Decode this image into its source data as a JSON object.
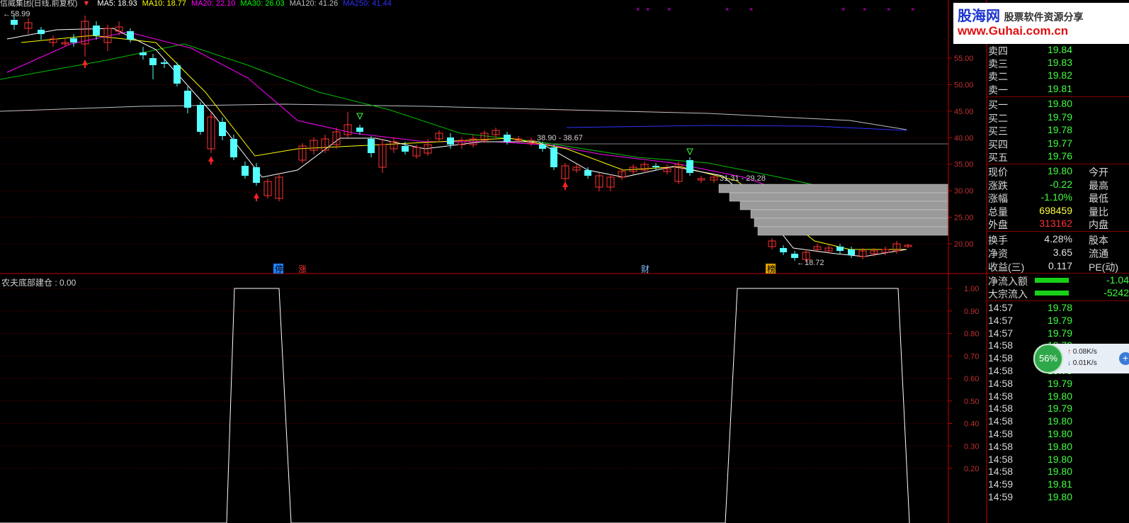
{
  "header": {
    "stock_title": "信威集团(日线,前复权)",
    "ma_items": [
      {
        "label": "MA5: 18.93",
        "color": "#ffffff"
      },
      {
        "label": "MA10: 18.77",
        "color": "#ffff00"
      },
      {
        "label": "MA20: 22.10",
        "color": "#ff00ff"
      },
      {
        "label": "MA30: 26.03",
        "color": "#00ff00"
      },
      {
        "label": "MA120: 41.26",
        "color": "#c0c0c0"
      },
      {
        "label": "MA250: 41.44",
        "color": "#3030ff"
      }
    ],
    "high_marker": "58.99"
  },
  "colors": {
    "up": "#ff3232",
    "down": "#54ffff",
    "grid": "#800000",
    "axis": "#c00000",
    "hline": "#808080"
  },
  "main_chart": {
    "y_ticks": [
      "55.00",
      "50.00",
      "45.00",
      "40.00",
      "35.00",
      "30.00",
      "25.00",
      "20.00"
    ],
    "annotations": [
      "38.90 - 38.67",
      "31.31 - 29.28",
      "18.72"
    ],
    "markers": [
      "停",
      "涨",
      "财",
      "榜"
    ]
  },
  "indicator": {
    "title": "农夫底部建仓 : 0.00",
    "y_ticks": [
      "1.00",
      "0.90",
      "0.80",
      "0.70",
      "0.60",
      "0.50",
      "0.40",
      "0.30",
      "0.20"
    ]
  },
  "quote_panel": {
    "asks": [
      {
        "label": "卖四",
        "price": "19.84"
      },
      {
        "label": "卖三",
        "price": "19.83"
      },
      {
        "label": "卖二",
        "price": "19.82"
      },
      {
        "label": "卖一",
        "price": "19.81"
      }
    ],
    "bids": [
      {
        "label": "买一",
        "price": "19.80"
      },
      {
        "label": "买二",
        "price": "19.79"
      },
      {
        "label": "买三",
        "price": "19.78"
      },
      {
        "label": "买四",
        "price": "19.77"
      },
      {
        "label": "买五",
        "price": "19.76"
      }
    ],
    "stats": [
      {
        "label": "现价",
        "value": "19.80",
        "label2": "今开"
      },
      {
        "label": "涨跌",
        "value": "-0.22",
        "label2": "最高"
      },
      {
        "label": "涨幅",
        "value": "-1.10%",
        "label2": "最低"
      },
      {
        "label": "总量",
        "value": "698459",
        "label2": "量比"
      },
      {
        "label": "外盘",
        "value": "313162",
        "label2": "内盘"
      },
      {
        "label": "换手",
        "value": "4.28%",
        "label2": "股本"
      },
      {
        "label": "净资",
        "value": "3.65",
        "label2": "流通"
      },
      {
        "label": "收益(三)",
        "value": "0.117",
        "label2": "PE(动)"
      }
    ],
    "flows": [
      {
        "label": "净流入额",
        "value": "-1.04"
      },
      {
        "label": "大宗流入",
        "value": "-5242"
      }
    ],
    "ticks": [
      {
        "time": "14:57",
        "price": "19.78"
      },
      {
        "time": "14:57",
        "price": "19.79"
      },
      {
        "time": "14:57",
        "price": "19.79"
      },
      {
        "time": "14:58",
        "price": "19.79"
      },
      {
        "time": "14:58",
        "price": "19.79"
      },
      {
        "time": "14:58",
        "price": "19.79"
      },
      {
        "time": "14:58",
        "price": "19.79"
      },
      {
        "time": "14:58",
        "price": "19.80"
      },
      {
        "time": "14:58",
        "price": "19.79"
      },
      {
        "time": "14:58",
        "price": "19.80"
      },
      {
        "time": "14:58",
        "price": "19.80"
      },
      {
        "time": "14:58",
        "price": "19.80"
      },
      {
        "time": "14:58",
        "price": "19.80"
      },
      {
        "time": "14:58",
        "price": "19.80"
      },
      {
        "time": "14:59",
        "price": "19.81"
      },
      {
        "time": "14:59",
        "price": "19.80"
      }
    ]
  },
  "logo": {
    "brand": "股海网",
    "tagline": "股票软件资源分享",
    "url": "www.Guhai.com.cn"
  },
  "speed_widget": {
    "percent": "56%",
    "up": "0.08K/s",
    "down": "0.01K/s"
  }
}
